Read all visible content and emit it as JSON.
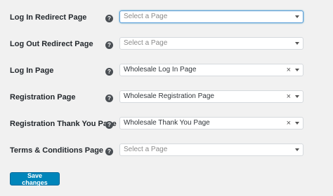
{
  "rows": [
    {
      "label": "Log In Redirect Page",
      "display": "Select a Page",
      "is_placeholder": true,
      "clearable": false,
      "focused": true,
      "help_icon": "question-icon"
    },
    {
      "label": "Log Out Redirect Page",
      "display": "Select a Page",
      "is_placeholder": true,
      "clearable": false,
      "focused": false,
      "help_icon": "question-icon"
    },
    {
      "label": "Log In Page",
      "display": "Wholesale Log In Page",
      "is_placeholder": false,
      "clearable": true,
      "focused": false,
      "help_icon": "question-icon"
    },
    {
      "label": "Registration Page",
      "display": "Wholesale Registration Page",
      "is_placeholder": false,
      "clearable": true,
      "focused": false,
      "help_icon": "question-icon"
    },
    {
      "label": "Registration Thank You Page",
      "display": "Wholesale Thank You Page",
      "is_placeholder": false,
      "clearable": true,
      "focused": false,
      "help_icon": "question-icon"
    },
    {
      "label": "Terms & Conditions Page",
      "display": "Select a Page",
      "is_placeholder": true,
      "clearable": false,
      "focused": false,
      "help_icon": "question-icon"
    }
  ],
  "help_glyph": "?",
  "clear_glyph": "×",
  "save_button": {
    "label": "Save changes"
  },
  "colors": {
    "accent": "#0085ba",
    "background": "#f1f1f1"
  }
}
